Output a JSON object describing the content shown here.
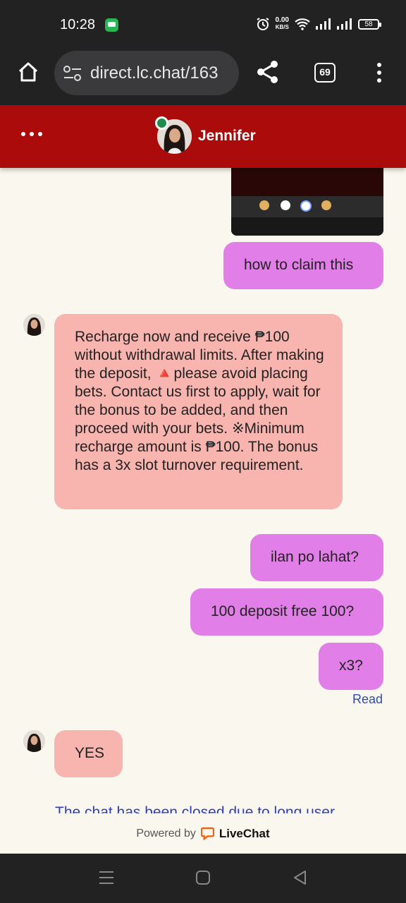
{
  "status_bar": {
    "time": "10:28",
    "net_speed_value": "0.00",
    "net_speed_unit": "KB/S",
    "battery": "58"
  },
  "browser": {
    "url": "direct.lc.chat/163",
    "tab_count": "69"
  },
  "chat_header": {
    "agent_name": "Jennifer"
  },
  "messages": {
    "out1": "how to claim this",
    "in1": "Recharge now and receive ₱100 without withdrawal limits. After making the deposit, 🔺please avoid placing bets. Contact us first to apply, wait for the bonus to be added, and then proceed with your bets. ※Minimum recharge amount is ₱100. The bonus has a 3x slot turnover requirement.",
    "out2": "ilan po lahat?",
    "out3": "100 deposit free 100?",
    "out4": "x3?",
    "read_status": "Read",
    "in2": "YES",
    "closed_note": "The chat has been closed due to long user"
  },
  "footer": {
    "powered_by": "Powered by",
    "brand": "LiveChat"
  },
  "colors": {
    "header_bg": "#ac0b0b",
    "outgoing_bubble": "#e27ee8",
    "incoming_bubble": "#f8b5b0",
    "chat_bg": "#faf7ee"
  }
}
